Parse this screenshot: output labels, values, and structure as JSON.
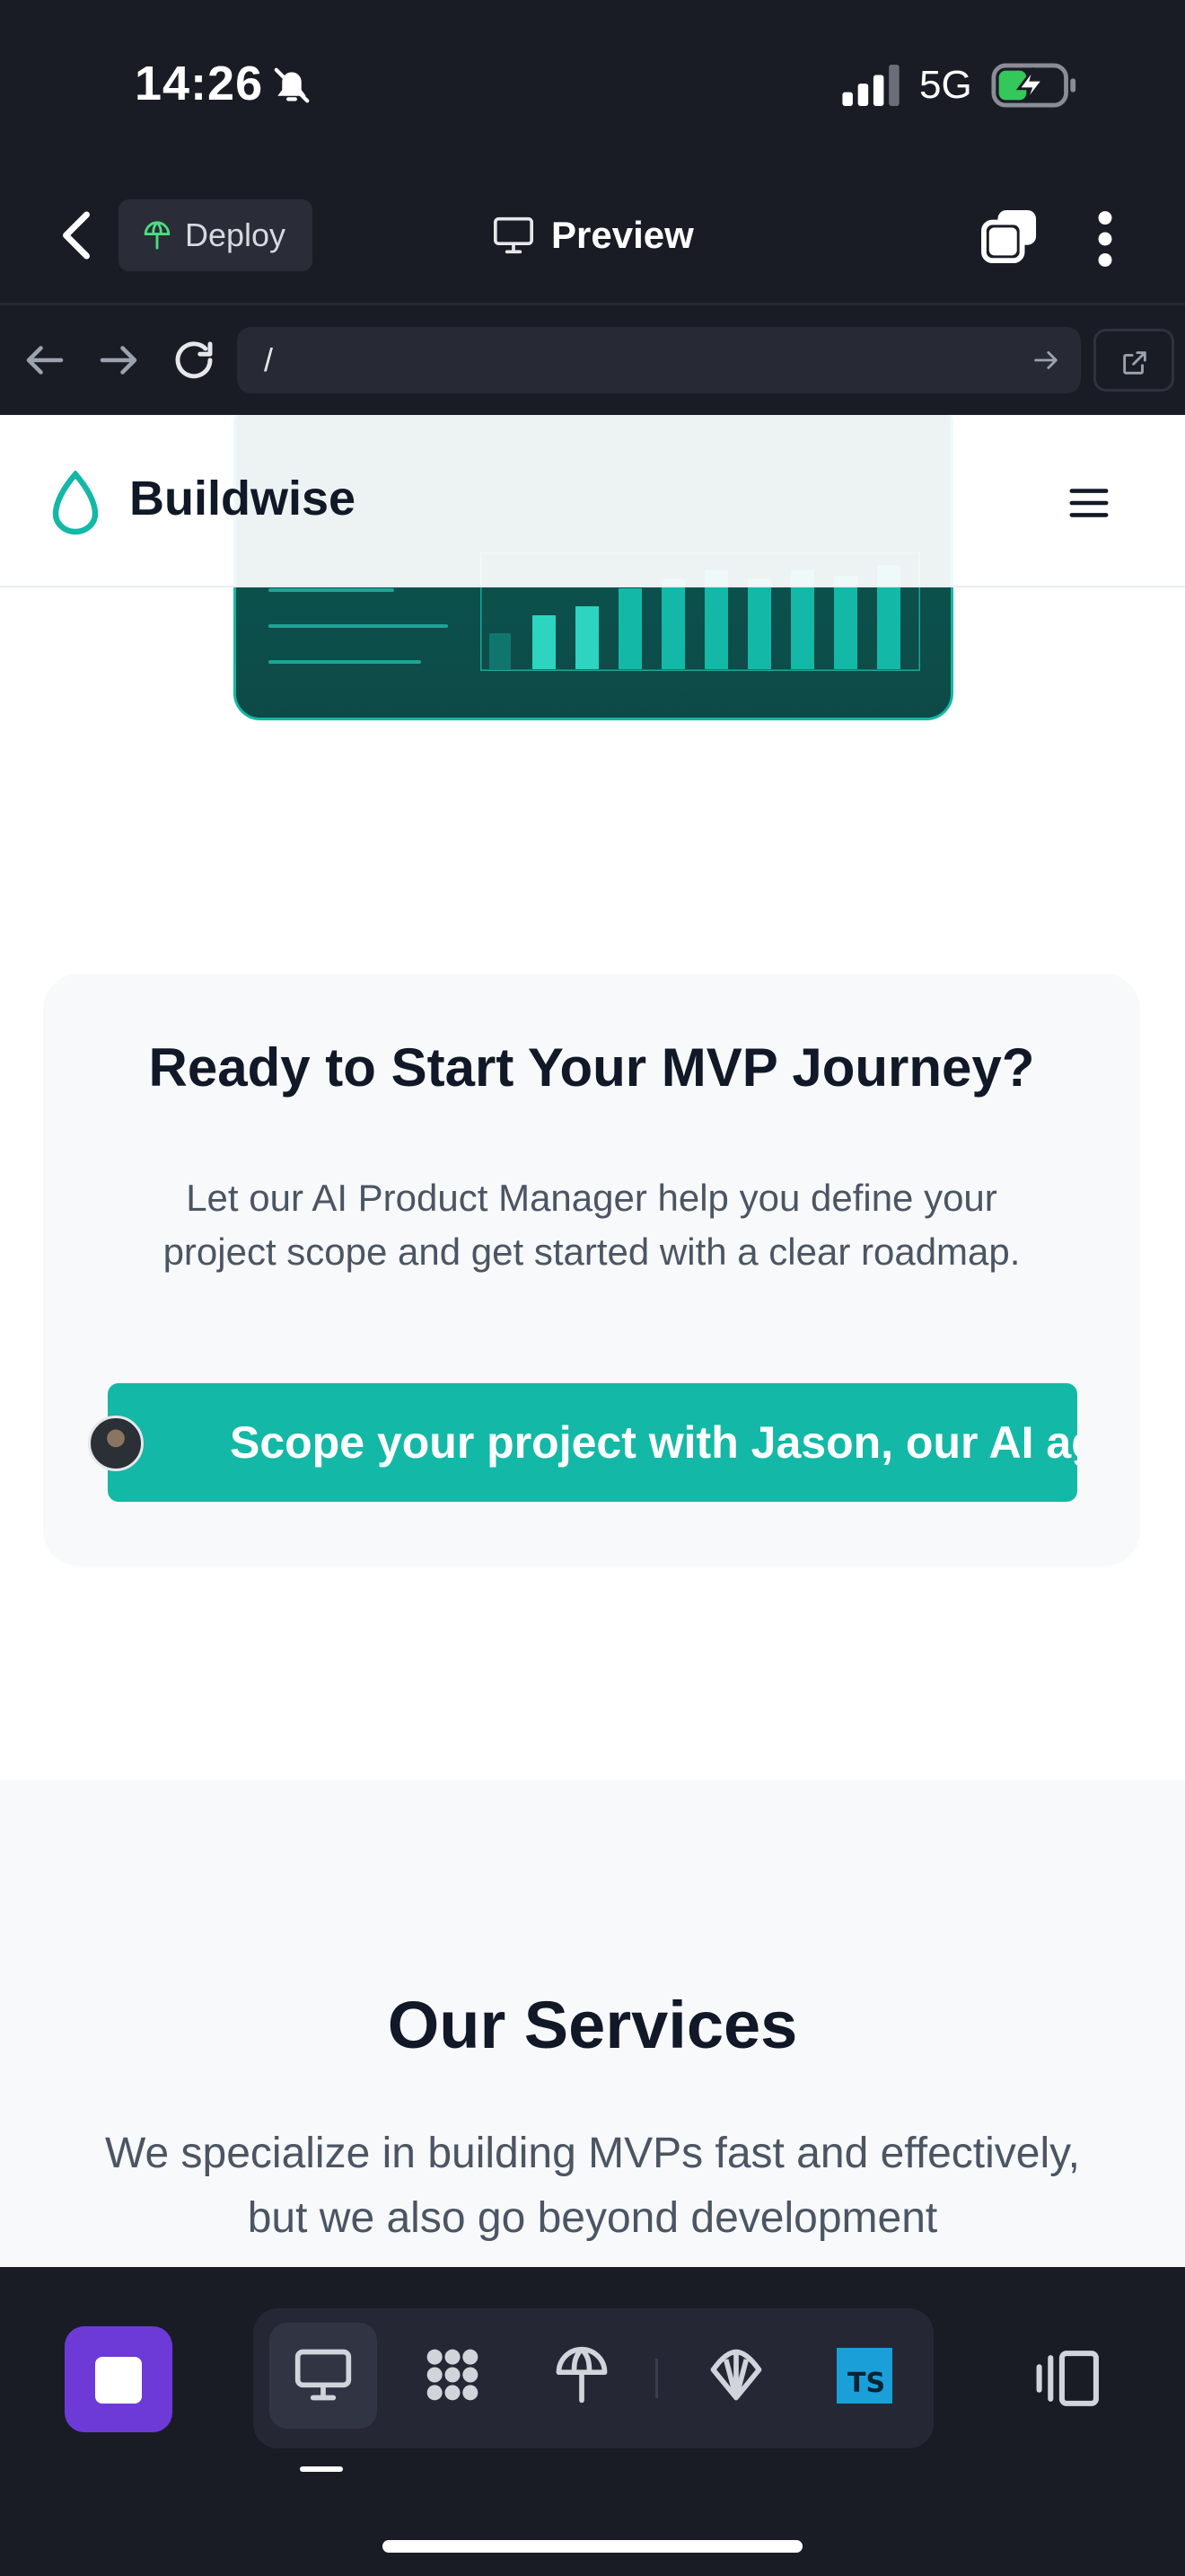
{
  "status_bar": {
    "time": "14:26",
    "network": "5G"
  },
  "app_bar": {
    "deploy_label": "Deploy",
    "title": "Preview"
  },
  "browser": {
    "url": "/"
  },
  "site": {
    "brand": "Buildwise",
    "cta": {
      "heading": "Ready to Start Your MVP Journey?",
      "text": "Let our AI Product Manager help you define your project scope and get started with a clear roadmap.",
      "button_label": "Scope your project with Jason, our AI agent"
    },
    "services": {
      "heading": "Our Services",
      "text": "We specialize in building MVPs fast and effectively, but we also go beyond development"
    }
  },
  "dock": {
    "ts_badge": "TS"
  },
  "colors": {
    "accent": "#14b8a6",
    "stop_button": "#6d3ad8",
    "chrome_bg": "#1a1c25"
  }
}
